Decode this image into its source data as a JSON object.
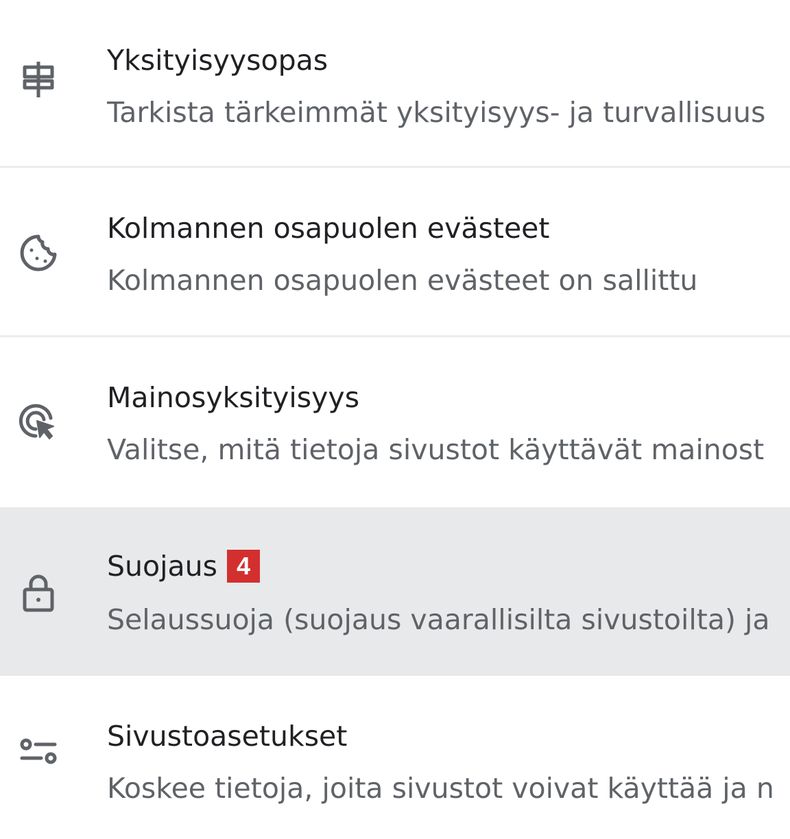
{
  "settings_list": {
    "items": [
      {
        "title": "Yksityisyysopas",
        "subtitle": "Tarkista tärkeimmät yksityisyys- ja turvallisuus",
        "icon": "signpost-icon"
      },
      {
        "title": "Kolmannen osapuolen evästeet",
        "subtitle": "Kolmannen osapuolen evästeet on sallittu",
        "icon": "cookie-icon"
      },
      {
        "title": "Mainosyksityisyys",
        "subtitle": "Valitse, mitä tietoja sivustot käyttävät mainost",
        "icon": "ad-target-icon"
      },
      {
        "title": "Suojaus",
        "subtitle": "Selaussuoja (suojaus vaarallisilta sivustoilta) ja",
        "icon": "lock-icon",
        "badge": "4",
        "selected": true
      },
      {
        "title": "Sivustoasetukset",
        "subtitle": "Koskee tietoja, joita sivustot voivat käyttää ja n",
        "icon": "site-settings-icon"
      }
    ]
  },
  "colors": {
    "selected_background": "#e8e9ea",
    "badge_background": "#d32f2f",
    "icon_color": "#5f6368"
  }
}
